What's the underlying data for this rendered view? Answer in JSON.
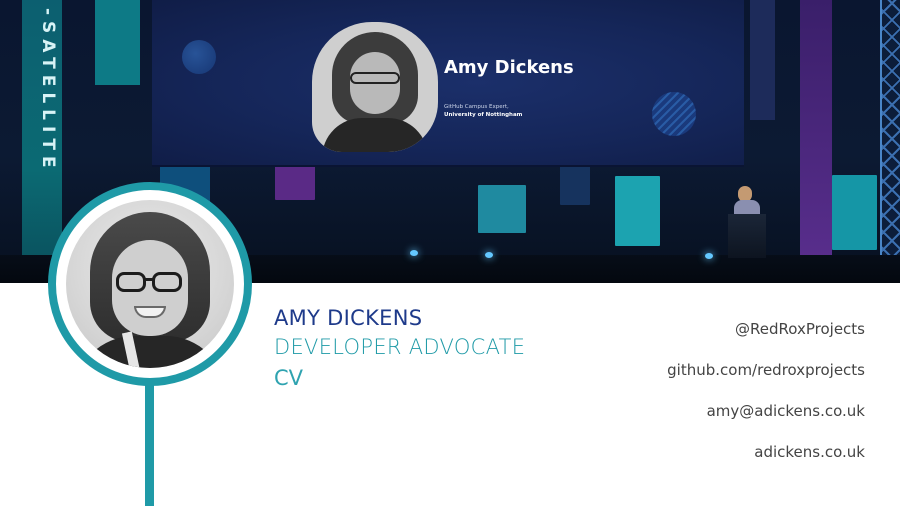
{
  "stage": {
    "banner_text": "-SATELLITE",
    "screen": {
      "speaker_name": "Amy Dickens",
      "speaker_role": "GitHub Campus Expert,",
      "speaker_org": "University of Nottingham"
    }
  },
  "profile": {
    "name": "AMY DICKENS",
    "role": "DEVELOPER ADVOCATE",
    "doc_type": "CV"
  },
  "contact": {
    "twitter": "@RedRoxProjects",
    "github": "github.com/redroxprojects",
    "email": "amy@adickens.co.uk",
    "website": "adickens.co.uk"
  },
  "colors": {
    "name": "#1e3a8a",
    "accent_teal": "#1f9aa7",
    "contact_text": "#444444"
  }
}
